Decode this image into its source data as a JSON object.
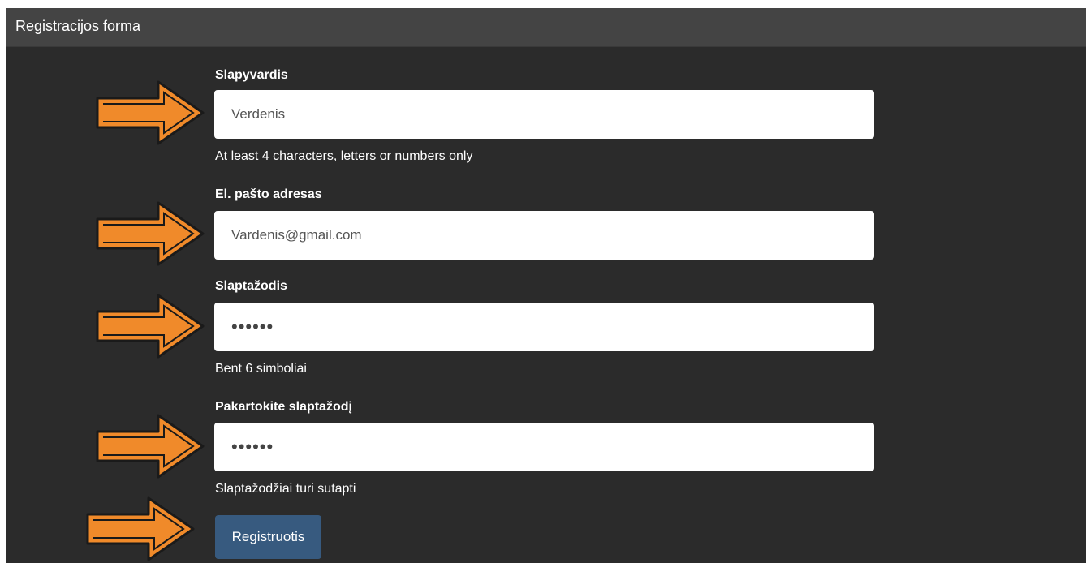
{
  "panel": {
    "title": "Registracijos forma"
  },
  "form": {
    "username": {
      "label": "Slapyvardis",
      "value": "Verdenis",
      "help": "At least 4 characters, letters or numbers only"
    },
    "email": {
      "label": "El. pašto adresas",
      "value": "Vardenis@gmail.com"
    },
    "password": {
      "label": "Slaptažodis",
      "value": "••••••",
      "help": "Bent 6 simboliai"
    },
    "password_repeat": {
      "label": "Pakartokite slaptažodį",
      "value": "••••••",
      "help": "Slaptažodžiai turi sutapti"
    },
    "submit_label": "Registruotis"
  },
  "annotations": {
    "arrow_icon": "right-arrow-icon",
    "arrow_color": "#f08a2a",
    "arrow_outline": "#1a1a1a"
  }
}
